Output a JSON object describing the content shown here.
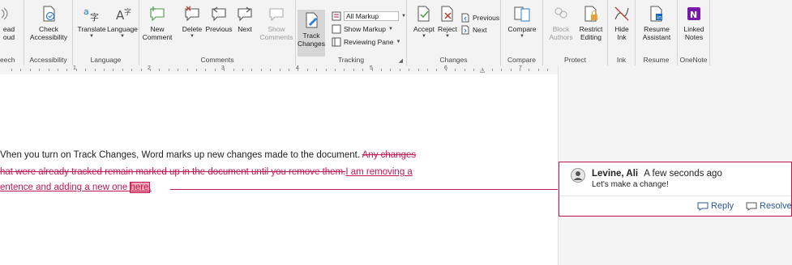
{
  "ribbon": {
    "speech": {
      "line1": "ead",
      "line2": "oud",
      "group": "eech"
    },
    "accessibility": {
      "button": "Check",
      "button2": "Accessibility",
      "group": "Accessibility"
    },
    "language": {
      "translate": "Translate",
      "language": "Language",
      "group": "Language"
    },
    "comments": {
      "new": "New",
      "new2": "Comment",
      "delete": "Delete",
      "previous": "Previous",
      "next": "Next",
      "show": "Show",
      "show2": "Comments",
      "group": "Comments"
    },
    "tracking": {
      "track": "Track",
      "track2": "Changes",
      "markup_select": "All Markup",
      "show_markup": "Show Markup",
      "reviewing_pane": "Reviewing Pane",
      "group": "Tracking"
    },
    "changes": {
      "accept": "Accept",
      "reject": "Reject",
      "previous": "Previous",
      "next": "Next",
      "group": "Changes"
    },
    "compare": {
      "button": "Compare",
      "group": "Compare"
    },
    "protect": {
      "block": "Block",
      "block2": "Authors",
      "restrict": "Restrict",
      "restrict2": "Editing",
      "group": "Protect"
    },
    "ink": {
      "hide": "Hide",
      "hide2": "Ink",
      "group": "Ink"
    },
    "resume": {
      "button": "Resume",
      "button2": "Assistant",
      "group": "Resume"
    },
    "onenote": {
      "button": "Linked",
      "button2": "Notes",
      "group": "OneNote"
    }
  },
  "ruler": {
    "numbers": [
      "1",
      "2",
      "3",
      "4",
      "5",
      "6",
      "7"
    ]
  },
  "document": {
    "line1_normal": "Vhen you turn on Track Changes, Word marks up new changes made to the document. ",
    "line1_deleted": "Any changes",
    "line2_deleted": "hat were already tracked remain marked up in the document until you remove them.",
    "line2_inserted": "I am removing a",
    "line3_inserted": "entence and adding a new one ",
    "line3_highlight": "here",
    "line3_end": "."
  },
  "comment": {
    "author": "Levine, Ali",
    "time": "A few seconds ago",
    "text": "Let's make a change!",
    "reply": "Reply",
    "resolve": "Resolve"
  },
  "colors": {
    "accent": "#2b579a",
    "revision": "#c0174e"
  }
}
